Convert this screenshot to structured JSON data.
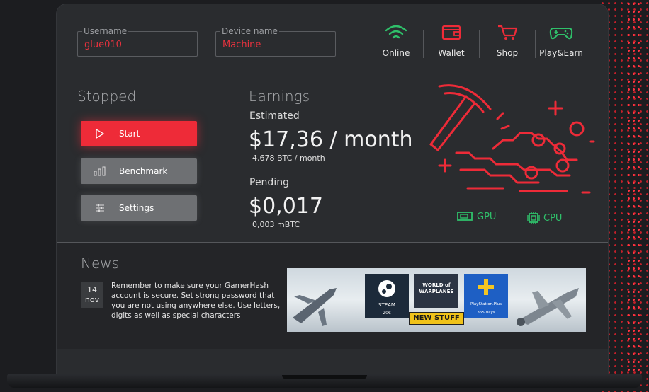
{
  "fields": {
    "username": {
      "label": "Username",
      "value": "glue010"
    },
    "device": {
      "label": "Device name",
      "value": "Machine"
    }
  },
  "nav": [
    {
      "label": "Online",
      "icon": "wifi-icon",
      "color": "#2fc06a"
    },
    {
      "label": "Wallet",
      "icon": "wallet-icon",
      "color": "#ee2b38"
    },
    {
      "label": "Shop",
      "icon": "cart-icon",
      "color": "#ee2b38"
    },
    {
      "label": "Play&Earn",
      "icon": "gamepad-icon",
      "color": "#2fc06a"
    }
  ],
  "status": {
    "title": "Stopped",
    "start_label": "Start",
    "benchmark_label": "Benchmark",
    "settings_label": "Settings"
  },
  "earnings": {
    "title": "Earnings",
    "estimated_label": "Estimated",
    "estimated_value": "$17,36 / month",
    "estimated_btc": "4,678 BTC / month",
    "pending_label": "Pending",
    "pending_value": "$0,017",
    "pending_btc": "0,003 mBTC"
  },
  "hardware": {
    "gpu": "GPU",
    "cpu": "CPU"
  },
  "news": {
    "title": "News",
    "day": "14",
    "month": "nov",
    "text": "Remember to make sure your GamerHash account is secure. Set strong password that you are not using anywhere else. Use letters, digits as well as special characters",
    "banner": {
      "steam": "STEAM",
      "steam_price": "20€",
      "game": "WORLD of WARPLANES",
      "new_stuff": "NEW STUFF",
      "psplus": "PlayStation.Plus",
      "psplus_days": "365 days"
    }
  },
  "colors": {
    "accent": "#ee2b38",
    "green": "#2fc06a"
  }
}
